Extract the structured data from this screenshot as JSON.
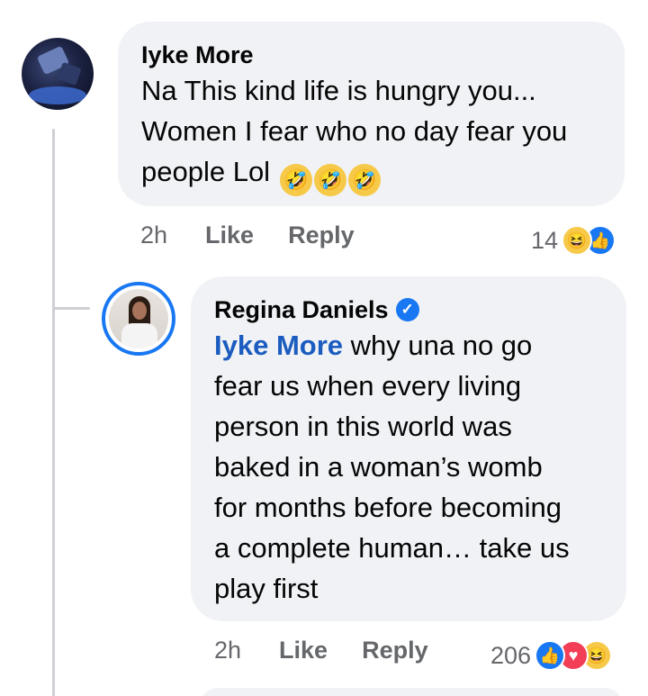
{
  "comment": {
    "author": "Iyke More",
    "lines": [
      "Na This kind life is hungry you...",
      "Women I fear who no day fear you",
      "people Lol"
    ],
    "emoji": [
      "🤣",
      "🤣",
      "🤣"
    ],
    "time": "2h",
    "like_label": "Like",
    "reply_label": "Reply",
    "reaction_count": "14",
    "reactions": [
      "haha",
      "like"
    ]
  },
  "reply": {
    "author": "Regina Daniels",
    "verified": true,
    "mention": "Iyke More",
    "lines": [
      " why una no go",
      "fear us when every living",
      "person in this world was",
      "baked in a woman’s womb",
      "for months before becoming",
      "a complete human… take us",
      "play first"
    ],
    "time": "2h",
    "like_label": "Like",
    "reply_label": "Reply",
    "reaction_count": "206",
    "reactions": [
      "like",
      "love",
      "haha"
    ]
  },
  "colors": {
    "bubble": "#f0f2f5",
    "accent": "#1877f2",
    "mention": "#1a5cbf",
    "meta": "#65676b"
  }
}
